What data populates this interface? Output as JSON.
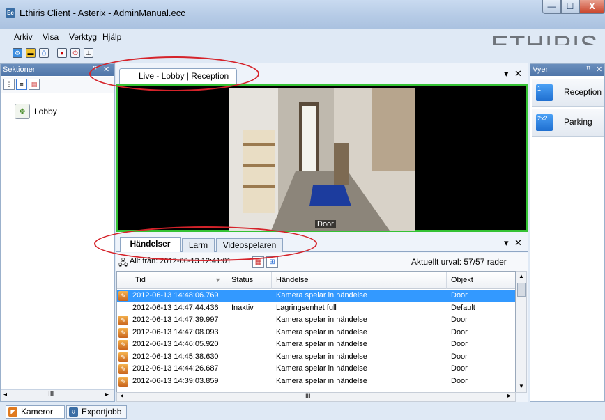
{
  "window": {
    "app_icon": "Ec",
    "title": "Ethiris Client - Asterix - AdminManual.ecc",
    "minimize": "—",
    "maximize": "☐",
    "close": "X"
  },
  "menu": [
    "Arkiv",
    "Visa",
    "Verktyg",
    "Hjälp"
  ],
  "logo": "ETHIRIS",
  "left_panel": {
    "title": "Sektioner",
    "pin": "ꟸ",
    "close": "✕",
    "items": [
      {
        "label": "Lobby",
        "icon": "camera-group-icon"
      }
    ]
  },
  "live": {
    "tab_label": "Live - Lobby | Reception",
    "camera_label": "Door",
    "menu_arrow": "▾",
    "close": "✕"
  },
  "events": {
    "tabs": [
      "Händelser",
      "Larm",
      "Videospelaren"
    ],
    "filter": "Allt från: 2012-06-13 12:41:01",
    "selection": "Aktuellt urval: 57/57 rader",
    "columns": [
      "Tid",
      "Status",
      "Händelse",
      "Objekt"
    ],
    "rows": [
      {
        "tid": "2012-06-13 14:48:06.769",
        "status": "",
        "handelse": "Kamera spelar in händelse",
        "objekt": "Door",
        "selected": true,
        "icon": true
      },
      {
        "tid": "2012-06-13 14:47:44.436",
        "status": "Inaktiv",
        "handelse": "Lagringsenhet full",
        "objekt": "Default",
        "selected": false,
        "icon": false
      },
      {
        "tid": "2012-06-13 14:47:39.997",
        "status": "",
        "handelse": "Kamera spelar in händelse",
        "objekt": "Door",
        "selected": false,
        "icon": true
      },
      {
        "tid": "2012-06-13 14:47:08.093",
        "status": "",
        "handelse": "Kamera spelar in händelse",
        "objekt": "Door",
        "selected": false,
        "icon": true
      },
      {
        "tid": "2012-06-13 14:46:05.920",
        "status": "",
        "handelse": "Kamera spelar in händelse",
        "objekt": "Door",
        "selected": false,
        "icon": true
      },
      {
        "tid": "2012-06-13 14:45:38.630",
        "status": "",
        "handelse": "Kamera spelar in händelse",
        "objekt": "Door",
        "selected": false,
        "icon": true
      },
      {
        "tid": "2012-06-13 14:44:26.687",
        "status": "",
        "handelse": "Kamera spelar in händelse",
        "objekt": "Door",
        "selected": false,
        "icon": true
      },
      {
        "tid": "2012-06-13 14:39:03.859",
        "status": "",
        "handelse": "Kamera spelar in händelse",
        "objekt": "Door",
        "selected": false,
        "icon": true
      }
    ],
    "scroll_thumb": "III"
  },
  "right_panel": {
    "title": "Vyer",
    "pin": "ꟸ",
    "close": "✕",
    "views": [
      {
        "label": "Reception",
        "badge": "1"
      },
      {
        "label": "Parking",
        "badge": "2x2"
      }
    ]
  },
  "status_tabs": [
    "Kameror",
    "Exportjobb"
  ],
  "colors": {
    "accent": "#3399ff",
    "live_border": "#34c234",
    "annotation": "#d5232a"
  }
}
